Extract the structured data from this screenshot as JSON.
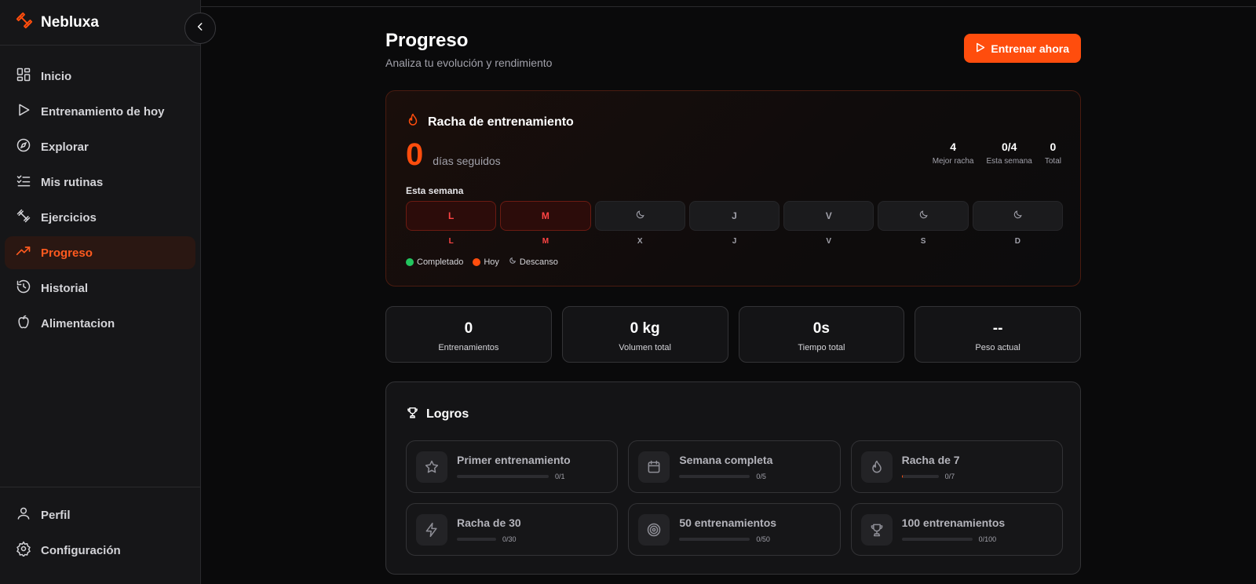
{
  "app": {
    "name": "Nebluxa",
    "accent": "#ff4d0d"
  },
  "sidebar": {
    "items": [
      {
        "label": "Inicio",
        "icon": "grid-icon"
      },
      {
        "label": "Entrenamiento de hoy",
        "icon": "play-icon"
      },
      {
        "label": "Explorar",
        "icon": "compass-icon"
      },
      {
        "label": "Mis rutinas",
        "icon": "checklist-icon"
      },
      {
        "label": "Ejercicios",
        "icon": "dumbbell-icon"
      },
      {
        "label": "Progreso",
        "icon": "trend-up-icon",
        "active": true
      },
      {
        "label": "Historial",
        "icon": "history-icon"
      },
      {
        "label": "Alimentacion",
        "icon": "apple-icon"
      }
    ],
    "bottom": [
      {
        "label": "Perfil",
        "icon": "user-icon"
      },
      {
        "label": "Configuración",
        "icon": "settings-icon"
      }
    ]
  },
  "header": {
    "title": "Progreso",
    "subtitle": "Analiza tu evolución y rendimiento",
    "cta_label": "Entrenar ahora"
  },
  "streak": {
    "title": "Racha de entrenamiento",
    "count": "0",
    "count_label": "días seguidos",
    "stats": [
      {
        "value": "4",
        "label": "Mejor racha"
      },
      {
        "value": "0/4",
        "label": "Esta semana"
      },
      {
        "value": "0",
        "label": "Total"
      }
    ],
    "week_label": "Esta semana",
    "days": [
      {
        "box": "L",
        "label": "L",
        "state": "hot"
      },
      {
        "box": "M",
        "label": "M",
        "state": "hot"
      },
      {
        "box": "",
        "label": "X",
        "state": "rest"
      },
      {
        "box": "J",
        "label": "J",
        "state": "normal"
      },
      {
        "box": "V",
        "label": "V",
        "state": "normal"
      },
      {
        "box": "",
        "label": "S",
        "state": "rest"
      },
      {
        "box": "",
        "label": "D",
        "state": "rest"
      }
    ],
    "legend": {
      "completed": "Completado",
      "today": "Hoy",
      "rest": "Descanso",
      "completed_color": "#22c55e",
      "today_color": "#ff4d0d"
    }
  },
  "stats": [
    {
      "value": "0",
      "label": "Entrenamientos"
    },
    {
      "value": "0 kg",
      "label": "Volumen total"
    },
    {
      "value": "0s",
      "label": "Tiempo total"
    },
    {
      "value": "--",
      "label": "Peso actual"
    }
  ],
  "achievements": {
    "title": "Logros",
    "items": [
      {
        "title": "Primer entrenamiento",
        "progress": "0/1",
        "fraction": 0,
        "icon": "star-icon"
      },
      {
        "title": "Semana completa",
        "progress": "0/5",
        "fraction": 0,
        "icon": "calendar-icon"
      },
      {
        "title": "Racha de 7",
        "progress": "0/7",
        "fraction": 0.02,
        "icon": "flame-icon"
      },
      {
        "title": "Racha de 30",
        "progress": "0/30",
        "fraction": 0,
        "icon": "bolt-icon"
      },
      {
        "title": "50 entrenamientos",
        "progress": "0/50",
        "fraction": 0,
        "icon": "target-icon"
      },
      {
        "title": "100 entrenamientos",
        "progress": "0/100",
        "fraction": 0,
        "icon": "trophy-icon"
      }
    ]
  }
}
